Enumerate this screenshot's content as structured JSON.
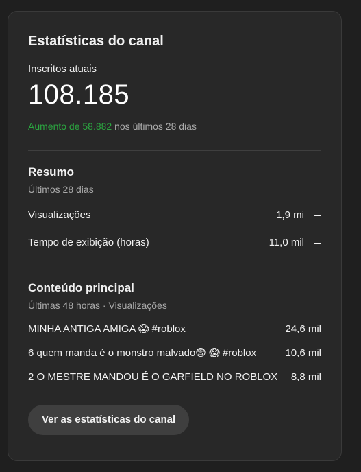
{
  "card": {
    "title": "Estatísticas do canal",
    "subscribers_label": "Inscritos atuais",
    "subscribers_value": "108.185",
    "delta_highlight": "Aumento de 58.882",
    "delta_rest": " nos últimos 28 dias"
  },
  "summary": {
    "title": "Resumo",
    "period": "Últimos 28 dias",
    "metrics": [
      {
        "label": "Visualizações",
        "value": "1,9 mi"
      },
      {
        "label": "Tempo de exibição (horas)",
        "value": "11,0 mil"
      }
    ]
  },
  "top_content": {
    "title": "Conteúdo principal",
    "period": "Últimas 48 horas · Visualizações",
    "items": [
      {
        "title": "MINHA ANTIGA AMIGA 😱 #roblox",
        "views": "24,6 mil"
      },
      {
        "title": "6 quem manda é o monstro malvado😨 😱 #roblox",
        "views": "10,6 mil"
      },
      {
        "title": "2 O MESTRE MANDOU É O GARFIELD NO ROBLOX",
        "views": "8,8 mil"
      }
    ]
  },
  "actions": {
    "view_stats_label": "Ver as estatísticas do canal"
  },
  "colors": {
    "positive": "#2ba640",
    "card_bg": "#282828",
    "page_bg": "#1f1f1f"
  }
}
